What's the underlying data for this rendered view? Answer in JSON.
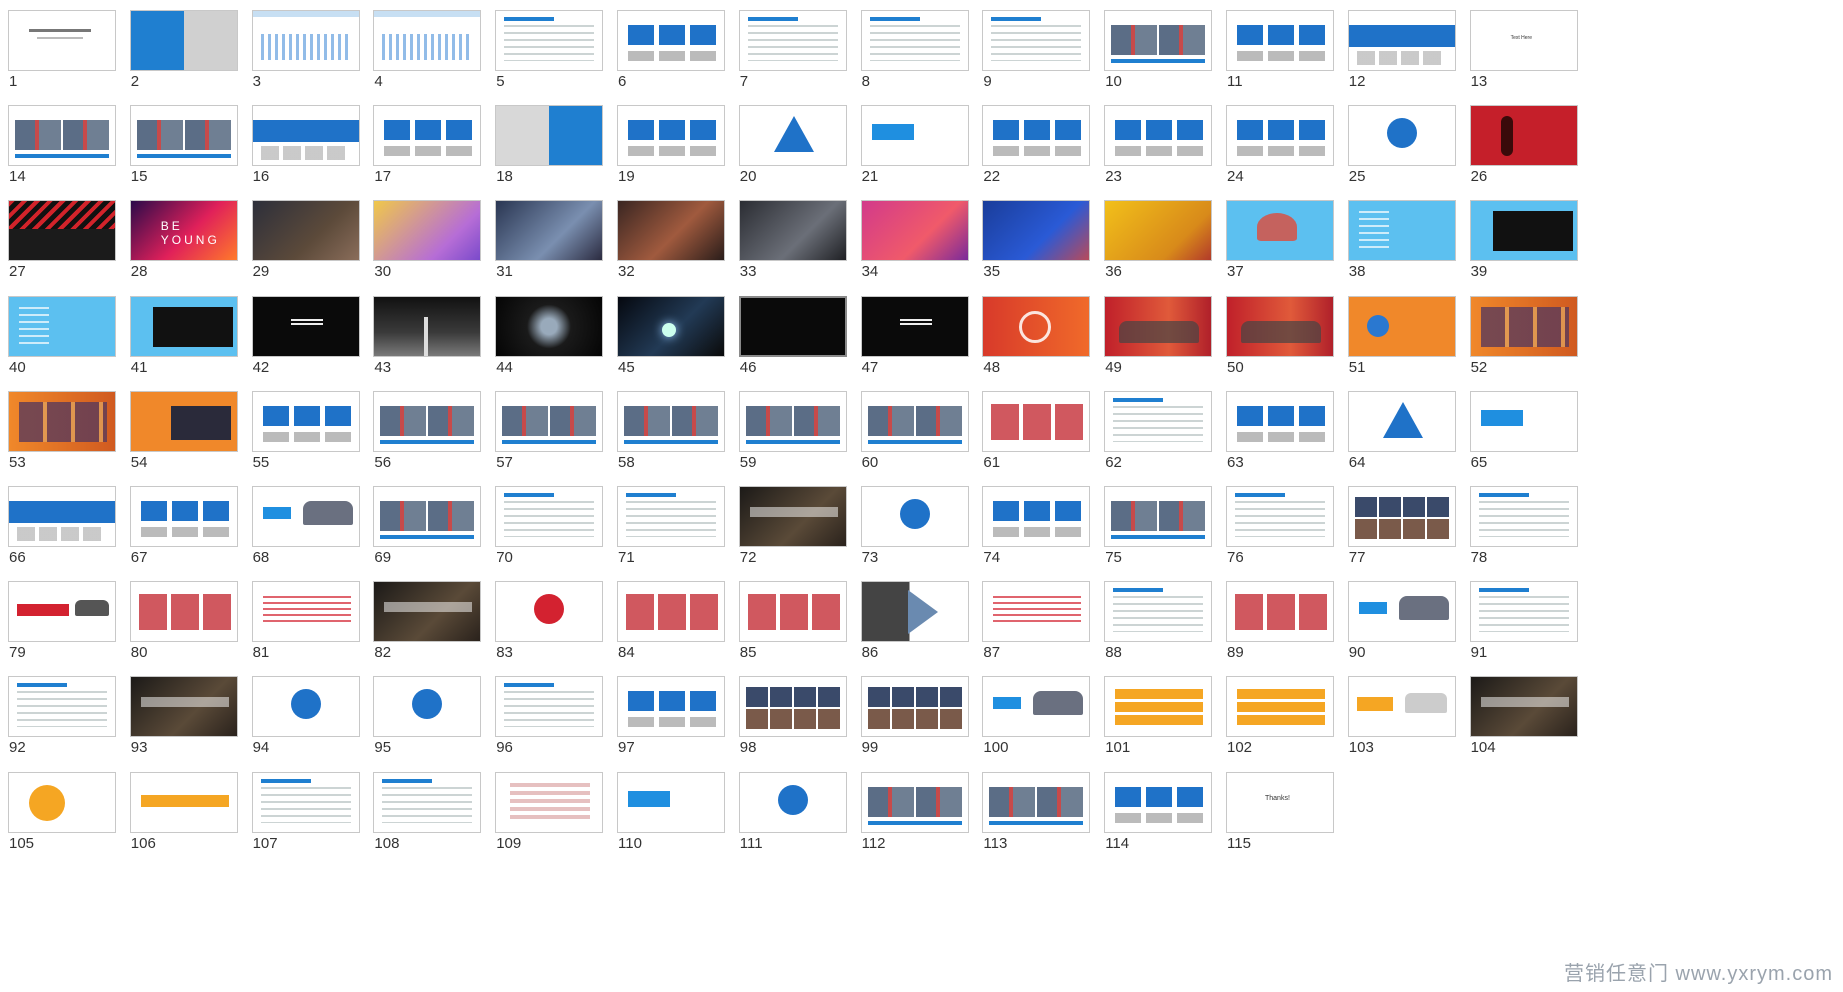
{
  "slides": [
    {
      "n": "1",
      "style": "s-title"
    },
    {
      "n": "2",
      "style": "s-split"
    },
    {
      "n": "3",
      "style": "s-chart"
    },
    {
      "n": "4",
      "style": "s-chart"
    },
    {
      "n": "5",
      "style": "s-doc"
    },
    {
      "n": "6",
      "style": "s-bluebox"
    },
    {
      "n": "7",
      "style": "s-doc"
    },
    {
      "n": "8",
      "style": "s-doc"
    },
    {
      "n": "9",
      "style": "s-doc"
    },
    {
      "n": "10",
      "style": "s-photos"
    },
    {
      "n": "11",
      "style": "s-bluebox"
    },
    {
      "n": "12",
      "style": "s-blueband"
    },
    {
      "n": "13",
      "style": "s-text"
    },
    {
      "n": "14",
      "style": "s-photos"
    },
    {
      "n": "15",
      "style": "s-photos"
    },
    {
      "n": "16",
      "style": "s-blueband"
    },
    {
      "n": "17",
      "style": "s-bluebox"
    },
    {
      "n": "18",
      "style": "s-split2"
    },
    {
      "n": "19",
      "style": "s-bluebox"
    },
    {
      "n": "20",
      "style": "s-tri"
    },
    {
      "n": "21",
      "style": "s-tag"
    },
    {
      "n": "22",
      "style": "s-bluebox"
    },
    {
      "n": "23",
      "style": "s-bluebox"
    },
    {
      "n": "24",
      "style": "s-bluebox"
    },
    {
      "n": "25",
      "style": "s-circle"
    },
    {
      "n": "26",
      "style": "s-red"
    },
    {
      "n": "27",
      "style": "s-stripe"
    },
    {
      "n": "28",
      "style": "s-neon"
    },
    {
      "n": "29",
      "style": "s-photo-dark"
    },
    {
      "n": "30",
      "style": "s-photo-gold"
    },
    {
      "n": "31",
      "style": "s-photo-night"
    },
    {
      "n": "32",
      "style": "s-photo-warm"
    },
    {
      "n": "33",
      "style": "s-photo-grey"
    },
    {
      "n": "34",
      "style": "s-pink"
    },
    {
      "n": "35",
      "style": "s-deepblue"
    },
    {
      "n": "36",
      "style": "s-yellow"
    },
    {
      "n": "37",
      "style": "s-sky"
    },
    {
      "n": "38",
      "style": "s-sky2"
    },
    {
      "n": "39",
      "style": "s-sky3"
    },
    {
      "n": "40",
      "style": "s-sky2"
    },
    {
      "n": "41",
      "style": "s-sky3"
    },
    {
      "n": "42",
      "style": "s-black-txt"
    },
    {
      "n": "43",
      "style": "s-road"
    },
    {
      "n": "44",
      "style": "s-glow"
    },
    {
      "n": "45",
      "style": "s-light"
    },
    {
      "n": "46",
      "style": "s-black",
      "selected": true
    },
    {
      "n": "47",
      "style": "s-black-txt"
    },
    {
      "n": "48",
      "style": "s-orange-red"
    },
    {
      "n": "49",
      "style": "s-car-red"
    },
    {
      "n": "50",
      "style": "s-car-red"
    },
    {
      "n": "51",
      "style": "s-orange"
    },
    {
      "n": "52",
      "style": "s-orange2"
    },
    {
      "n": "53",
      "style": "s-orange2"
    },
    {
      "n": "54",
      "style": "s-orange3"
    },
    {
      "n": "55",
      "style": "s-bluebox"
    },
    {
      "n": "56",
      "style": "s-photos"
    },
    {
      "n": "57",
      "style": "s-photos"
    },
    {
      "n": "58",
      "style": "s-photos"
    },
    {
      "n": "59",
      "style": "s-photos"
    },
    {
      "n": "60",
      "style": "s-photos"
    },
    {
      "n": "61",
      "style": "s-redgrid"
    },
    {
      "n": "62",
      "style": "s-doc"
    },
    {
      "n": "63",
      "style": "s-bluebox"
    },
    {
      "n": "64",
      "style": "s-tri"
    },
    {
      "n": "65",
      "style": "s-tag"
    },
    {
      "n": "66",
      "style": "s-blueband"
    },
    {
      "n": "67",
      "style": "s-bluebox"
    },
    {
      "n": "68",
      "style": "s-blue-tag2"
    },
    {
      "n": "69",
      "style": "s-photos"
    },
    {
      "n": "70",
      "style": "s-doc"
    },
    {
      "n": "71",
      "style": "s-doc"
    },
    {
      "n": "72",
      "style": "s-darkphoto"
    },
    {
      "n": "73",
      "style": "s-circle"
    },
    {
      "n": "74",
      "style": "s-bluebox"
    },
    {
      "n": "75",
      "style": "s-photos"
    },
    {
      "n": "76",
      "style": "s-doc"
    },
    {
      "n": "77",
      "style": "s-mosaic"
    },
    {
      "n": "78",
      "style": "s-doc"
    },
    {
      "n": "79",
      "style": "s-redbar"
    },
    {
      "n": "80",
      "style": "s-redgrid"
    },
    {
      "n": "81",
      "style": "s-redtext"
    },
    {
      "n": "82",
      "style": "s-darkphoto"
    },
    {
      "n": "83",
      "style": "s-circle-red"
    },
    {
      "n": "84",
      "style": "s-redgrid"
    },
    {
      "n": "85",
      "style": "s-redgrid"
    },
    {
      "n": "86",
      "style": "s-greyfade"
    },
    {
      "n": "87",
      "style": "s-redtext"
    },
    {
      "n": "88",
      "style": "s-doc"
    },
    {
      "n": "89",
      "style": "s-redgrid"
    },
    {
      "n": "90",
      "style": "s-blue-tag2"
    },
    {
      "n": "91",
      "style": "s-doc"
    },
    {
      "n": "92",
      "style": "s-doc"
    },
    {
      "n": "93",
      "style": "s-darkphoto"
    },
    {
      "n": "94",
      "style": "s-circle"
    },
    {
      "n": "95",
      "style": "s-circle"
    },
    {
      "n": "96",
      "style": "s-doc"
    },
    {
      "n": "97",
      "style": "s-bluebox"
    },
    {
      "n": "98",
      "style": "s-mosaic"
    },
    {
      "n": "99",
      "style": "s-mosaic"
    },
    {
      "n": "100",
      "style": "s-blue-tag2"
    },
    {
      "n": "101",
      "style": "s-orangebox"
    },
    {
      "n": "102",
      "style": "s-orangebox"
    },
    {
      "n": "103",
      "style": "s-orangetag"
    },
    {
      "n": "104",
      "style": "s-darkphoto"
    },
    {
      "n": "105",
      "style": "s-circle-orange"
    },
    {
      "n": "106",
      "style": "s-orangepie"
    },
    {
      "n": "107",
      "style": "s-doc"
    },
    {
      "n": "108",
      "style": "s-doc"
    },
    {
      "n": "109",
      "style": "s-rankchart"
    },
    {
      "n": "110",
      "style": "s-tag"
    },
    {
      "n": "111",
      "style": "s-circle"
    },
    {
      "n": "112",
      "style": "s-photos"
    },
    {
      "n": "113",
      "style": "s-photos"
    },
    {
      "n": "114",
      "style": "s-bluebox"
    },
    {
      "n": "115",
      "style": "s-thanks"
    }
  ],
  "watermark": "营销任意门 www.yxrym.com"
}
